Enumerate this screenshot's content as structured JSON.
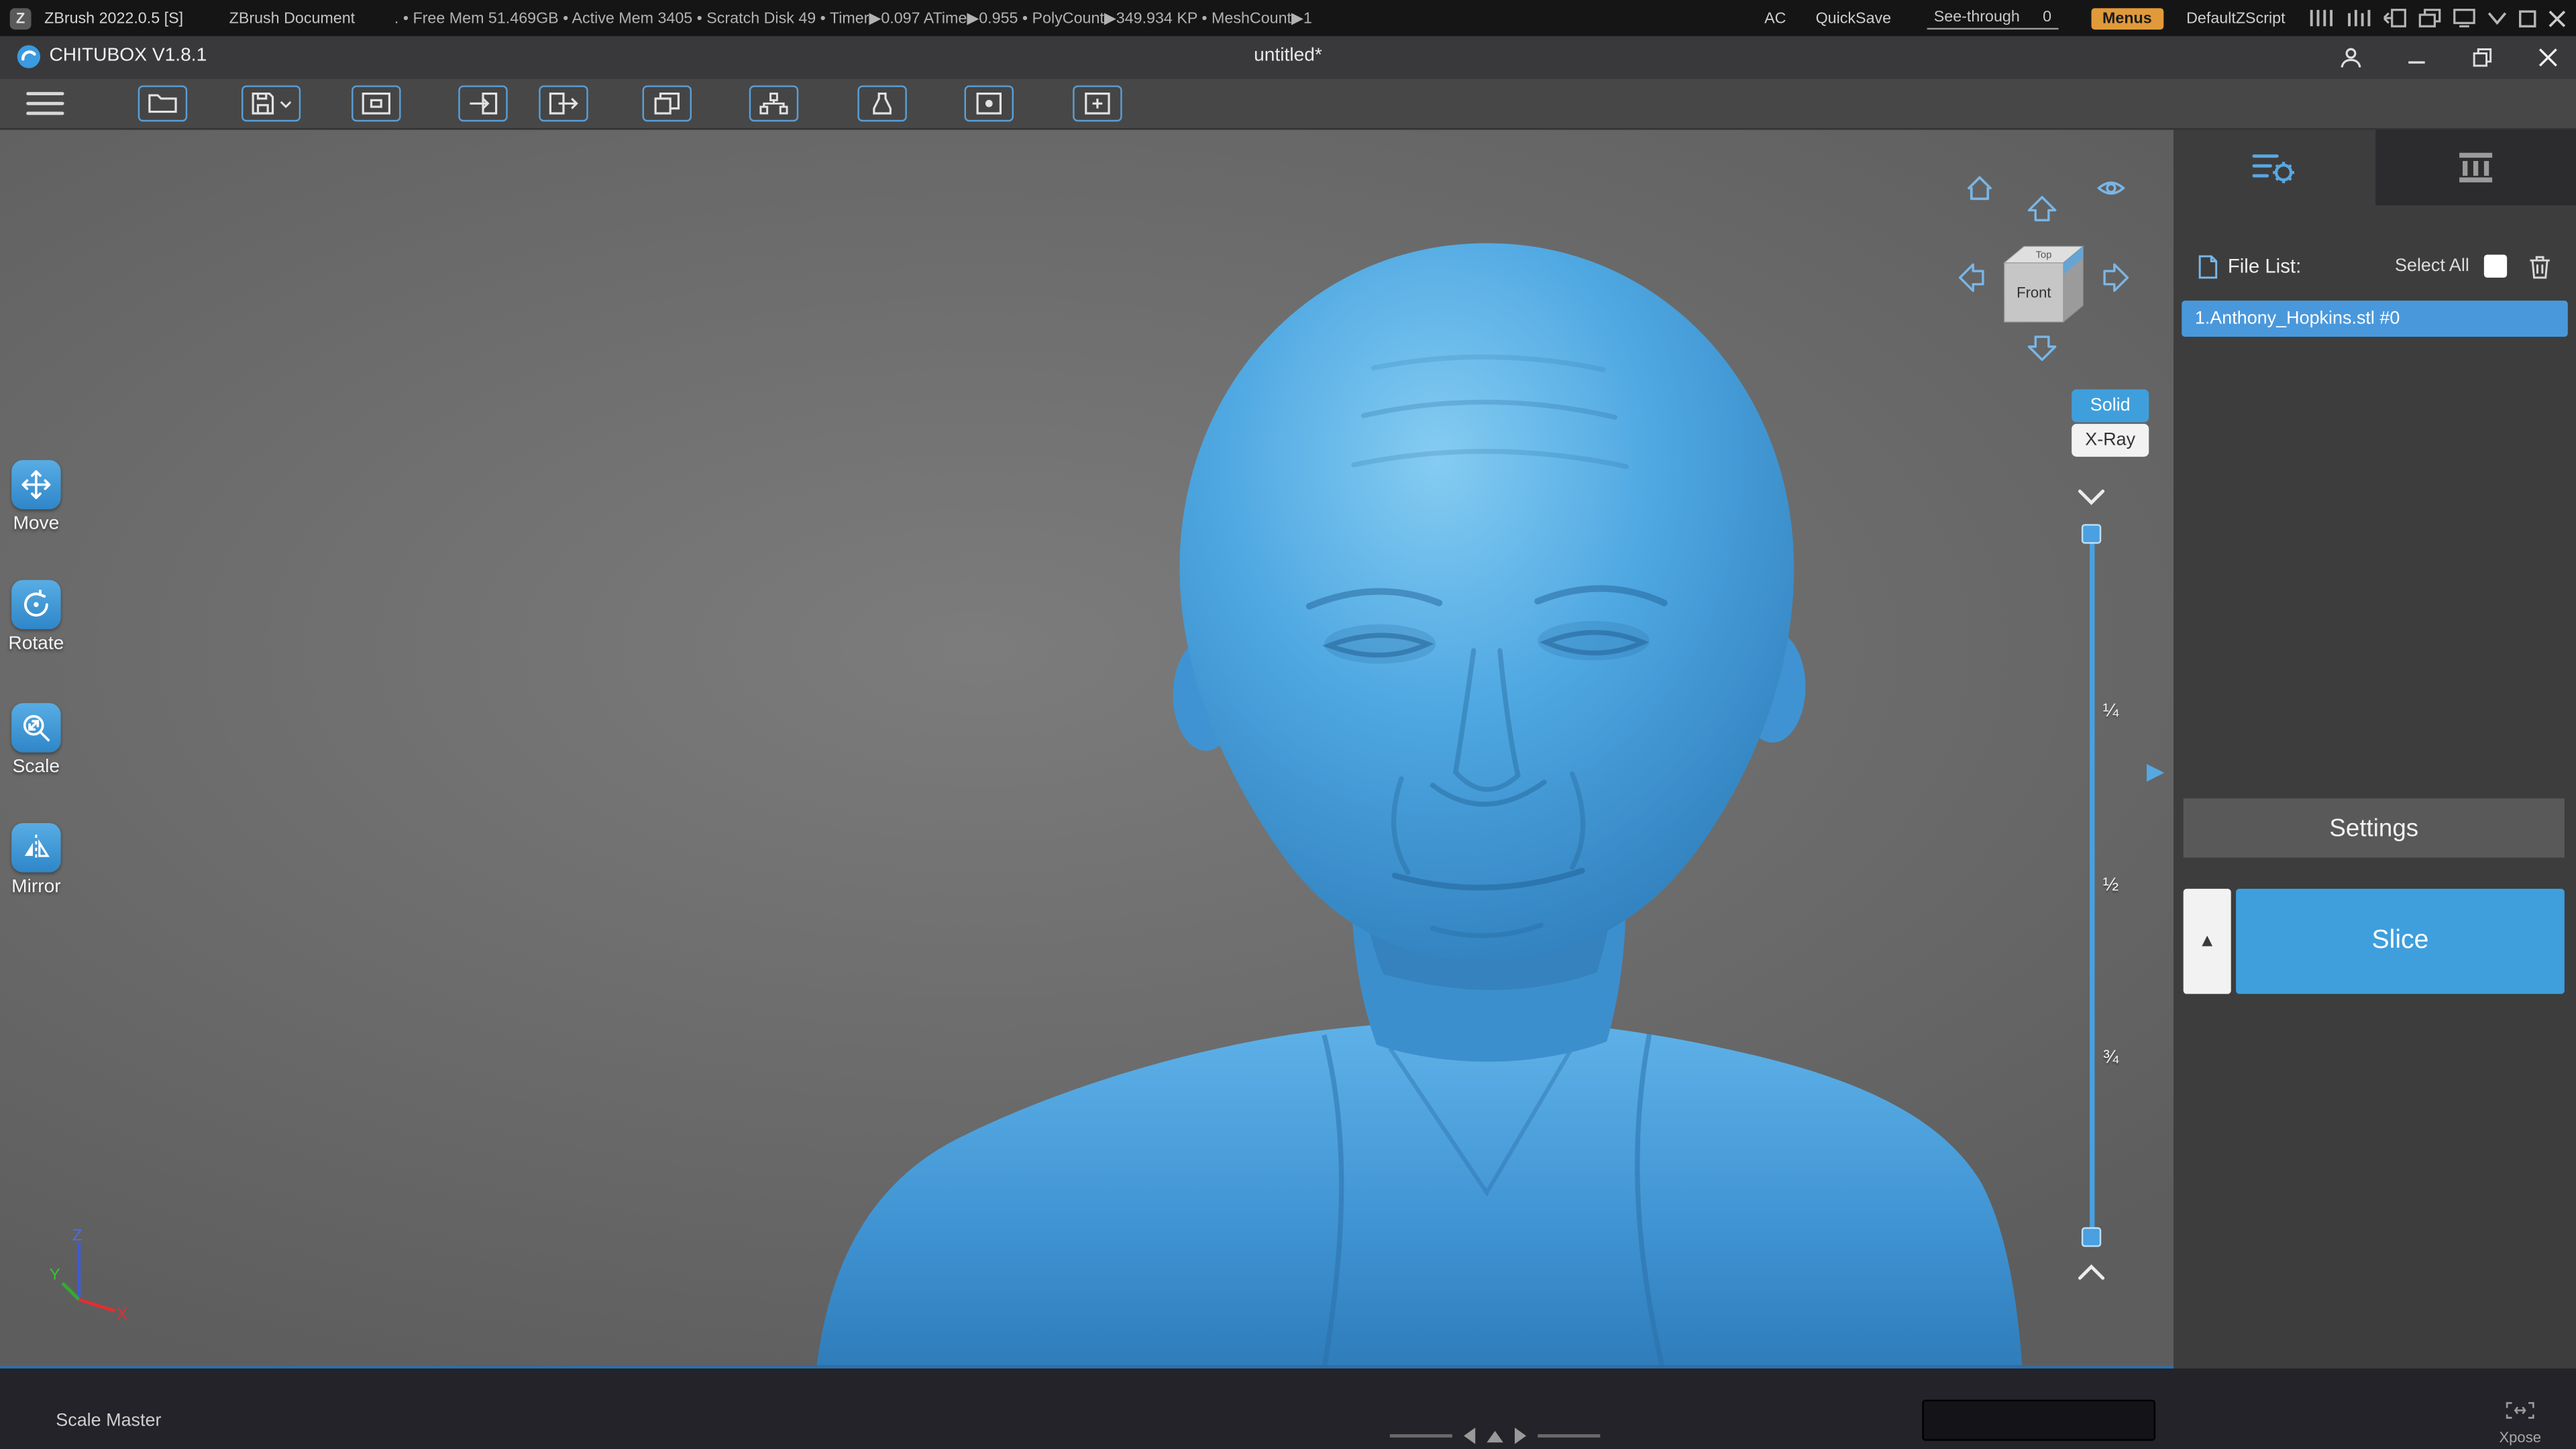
{
  "zbrush_bar": {
    "app_title": "ZBrush 2022.0.5 [S]",
    "document_label": "ZBrush Document",
    "stats": ". • Free Mem 51.469GB • Active Mem 3405 • Scratch Disk 49 • Timer▶0.097 ATime▶0.955 • PolyCount▶349.934 KP • MeshCount▶1",
    "ac_label": "AC",
    "quicksave_label": "QuickSave",
    "see_through_label": "See-through",
    "see_through_value": "0",
    "menus_label": "Menus",
    "zscript_label": "DefaultZScript"
  },
  "titlebar": {
    "app_title": "CHITUBOX V1.8.1",
    "document_title": "untitled*"
  },
  "tools": [
    {
      "label": "Move"
    },
    {
      "label": "Rotate"
    },
    {
      "label": "Scale"
    },
    {
      "label": "Mirror"
    }
  ],
  "viewcube": {
    "front": "Front",
    "top": "Top"
  },
  "view_modes": {
    "solid": "Solid",
    "xray": "X-Ray"
  },
  "slider": {
    "q1": "¼",
    "q2": "½",
    "q3": "¾"
  },
  "panel": {
    "file_list_label": "File List:",
    "select_all_label": "Select All",
    "file_name": "1.Anthony_Hopkins.stl #0",
    "settings_label": "Settings",
    "slice_label": "Slice"
  },
  "bottom": {
    "scale_master": "Scale Master",
    "xpose": "Xpose"
  },
  "glyphs": {
    "slice_up": "▲",
    "collapse": "▶"
  },
  "colors": {
    "accent_blue": "#3f9fdc",
    "menus_orange": "#e09a3a",
    "model_blue": "#4fa8e2",
    "selected_row": "#4a98dc"
  }
}
